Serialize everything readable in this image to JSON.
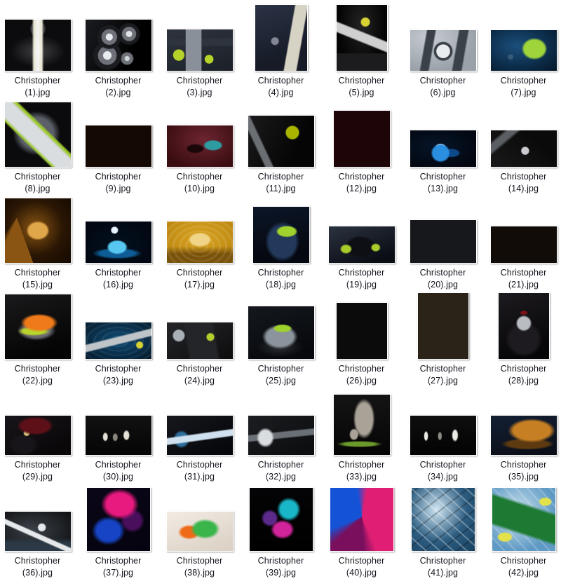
{
  "view": {
    "background_color": "#ffffff",
    "label_color": "#14141e",
    "columns": 7,
    "rows": 6,
    "item_count": 42,
    "name_prefix": "Christopher",
    "extension": ".jpg",
    "column_centers": [
      53,
      168,
      284,
      400,
      515,
      631,
      746
    ],
    "row_label_tops": [
      103,
      240,
      377,
      514,
      651,
      788
    ]
  },
  "files": [
    {
      "index": 1,
      "name_line1": "Christopher",
      "name_line2": "(1).jpg",
      "thumb": {
        "w": 94,
        "h": 73,
        "art": "flashlight-vertical-yellow",
        "bg": "#0c0c0f",
        "c1": "#e8e4d0",
        "c2": "#cfd532",
        "c3": "#3a3a42"
      }
    },
    {
      "index": 2,
      "name_line1": "Christopher",
      "name_line2": "(2).jpg",
      "thumb": {
        "w": 94,
        "h": 73,
        "art": "three-flashlight-heads",
        "bg": "#070709",
        "c1": "#b9bcc2",
        "c2": "#6e7278",
        "c3": "#1a1c20"
      }
    },
    {
      "index": 3,
      "name_line1": "Christopher",
      "name_line2": "(3).jpg",
      "thumb": {
        "w": 94,
        "h": 59,
        "art": "gear-flatlay-tools",
        "bg": "#1b2028",
        "c1": "#b6d32a",
        "c2": "#8a9099",
        "c3": "#2e343e"
      }
    },
    {
      "index": 4,
      "name_line1": "Christopher",
      "name_line2": "(4).jpg",
      "thumb": {
        "w": 74,
        "h": 94,
        "art": "dark-blue-box-package",
        "bg": "#161b27",
        "c1": "#d6d2c4",
        "c2": "#2b3345",
        "c3": "#7fb0cf"
      }
    },
    {
      "index": 5,
      "name_line1": "Christopher",
      "name_line2": "(5).jpg",
      "thumb": {
        "w": 72,
        "h": 94,
        "art": "flashlight-tilted-dark",
        "bg": "#050506",
        "c1": "#cfd0cf",
        "c2": "#d8d233",
        "c3": "#1c1c1e"
      }
    },
    {
      "index": 6,
      "name_line1": "Christopher",
      "name_line2": "(6).jpg",
      "thumb": {
        "w": 94,
        "h": 58,
        "art": "wet-chronograph-watch",
        "bg": "#9aa1a8",
        "c1": "#e9ecef",
        "c2": "#3b4149",
        "c3": "#c6ccd2"
      }
    },
    {
      "index": 7,
      "name_line1": "Christopher",
      "name_line2": "(7).jpg",
      "thumb": {
        "w": 94,
        "h": 58,
        "art": "green-dive-light-underwater",
        "bg": "#061728",
        "c1": "#9fd53a",
        "c2": "#1b4f7c",
        "c3": "#0c2c49"
      }
    },
    {
      "index": 8,
      "name_line1": "Christopher",
      "name_line2": "(8).jpg",
      "thumb": {
        "w": 94,
        "h": 92,
        "art": "green-torch-splash-spotlight",
        "bg": "#0b0b0d",
        "c1": "#d9dde0",
        "c2": "#9cc72e",
        "c3": "#5b6068"
      }
    },
    {
      "index": 9,
      "name_line1": "Christopher",
      "name_line2": "(9).jpg",
      "thumb": {
        "w": 94,
        "h": 59,
        "art": "orange-whisky-ice-bottle",
        "bg": "#150903",
        "c1": "#e79a22",
        "c2": "#c0611a",
        "c3": "#3a1a08"
      }
    },
    {
      "index": 10,
      "name_line1": "Christopher",
      "name_line2": "(10).jpg",
      "thumb": {
        "w": 94,
        "h": 59,
        "art": "teal-loafer-shoes-red",
        "bg": "#3a0d12",
        "c1": "#2f9aa0",
        "c2": "#6d2530",
        "c3": "#1b0609"
      }
    },
    {
      "index": 11,
      "name_line1": "Christopher",
      "name_line2": "(11).jpg",
      "thumb": {
        "w": 94,
        "h": 73,
        "art": "dark-machinery-green-dial",
        "bg": "#050505",
        "c1": "#aab500",
        "c2": "#6b6f74",
        "c3": "#1a1a1c"
      }
    },
    {
      "index": 12,
      "name_line1": "Christopher",
      "name_line2": "(12).jpg",
      "thumb": {
        "w": 80,
        "h": 80,
        "art": "silver-watch-red-glow",
        "bg": "#1d0508",
        "c1": "#e3e6ea",
        "c2": "#8b1420",
        "c3": "#4a0a10"
      }
    },
    {
      "index": 13,
      "name_line1": "Christopher",
      "name_line2": "(13).jpg",
      "thumb": {
        "w": 94,
        "h": 52,
        "art": "blue-cosmetic-jar",
        "bg": "#03060f",
        "c1": "#2a8fe0",
        "c2": "#0d4a8a",
        "c3": "#061528"
      }
    },
    {
      "index": 14,
      "name_line1": "Christopher",
      "name_line2": "(14).jpg",
      "thumb": {
        "w": 94,
        "h": 52,
        "art": "bw-camera-gear",
        "bg": "#0a0a0a",
        "c1": "#c9cbce",
        "c2": "#5b5e62",
        "c3": "#19191b"
      }
    },
    {
      "index": 15,
      "name_line1": "Christopher",
      "name_line2": "(15).jpg",
      "thumb": {
        "w": 94,
        "h": 92,
        "art": "gold-jar-amber-silk",
        "bg": "#120800",
        "c1": "#e0a64a",
        "c2": "#8a5512",
        "c3": "#2a1604"
      }
    },
    {
      "index": 16,
      "name_line1": "Christopher",
      "name_line2": "(16).jpg",
      "thumb": {
        "w": 94,
        "h": 59,
        "art": "blue-jar-moon",
        "bg": "#020610",
        "c1": "#57c7f2",
        "c2": "#0e5d96",
        "c3": "#03111f"
      }
    },
    {
      "index": 17,
      "name_line1": "Christopher",
      "name_line2": "(17).jpg",
      "thumb": {
        "w": 94,
        "h": 59,
        "art": "gold-jar-ripples",
        "bg": "#b7820d",
        "c1": "#f0d488",
        "c2": "#7a530a",
        "c3": "#d9a422"
      }
    },
    {
      "index": 18,
      "name_line1": "Christopher",
      "name_line2": "(18).jpg",
      "thumb": {
        "w": 80,
        "h": 80,
        "art": "blue-helmet-green-accent",
        "bg": "#050810",
        "c1": "#9fd22c",
        "c2": "#23395c",
        "c3": "#0c1628"
      }
    },
    {
      "index": 19,
      "name_line1": "Christopher",
      "name_line2": "(19).jpg",
      "thumb": {
        "w": 94,
        "h": 52,
        "art": "black-helmet-green-trim",
        "bg": "#0a0d14",
        "c1": "#a8cd2b",
        "c2": "#2b3240",
        "c3": "#11151e"
      }
    },
    {
      "index": 20,
      "name_line1": "Christopher",
      "name_line2": "(20).jpg",
      "thumb": {
        "w": 94,
        "h": 61,
        "art": "tool-bench-flatlay",
        "bg": "#16181b",
        "c1": "#b6d32a",
        "c2": "#71757c",
        "c3": "#26292e"
      }
    },
    {
      "index": 21,
      "name_line1": "Christopher",
      "name_line2": "(21).jpg",
      "thumb": {
        "w": 94,
        "h": 52,
        "art": "bottle-dust-explosion",
        "bg": "#120c08",
        "c1": "#d8d4cc",
        "c2": "#7a6248",
        "c3": "#241a12"
      }
    },
    {
      "index": 22,
      "name_line1": "Christopher",
      "name_line2": "(22).jpg",
      "thumb": {
        "w": 94,
        "h": 92,
        "art": "orange-running-shoe",
        "bg": "#050505",
        "c1": "#ef7a1a",
        "c2": "#b8d32a",
        "c3": "#1a1a1c"
      }
    },
    {
      "index": 23,
      "name_line1": "Christopher",
      "name_line2": "(23).jpg",
      "thumb": {
        "w": 94,
        "h": 52,
        "art": "flashlight-blue-water",
        "bg": "#061c2e",
        "c1": "#bfc4c8",
        "c2": "#0f4b74",
        "c3": "#d6d233"
      }
    },
    {
      "index": 24,
      "name_line1": "Christopher",
      "name_line2": "(24).jpg",
      "thumb": {
        "w": 94,
        "h": 52,
        "art": "garage-tools-green-light",
        "bg": "#0d0d0e",
        "c1": "#a8b0b6",
        "c2": "#b4cf2c",
        "c3": "#242528"
      }
    },
    {
      "index": 25,
      "name_line1": "Christopher",
      "name_line2": "(25).jpg",
      "thumb": {
        "w": 94,
        "h": 75,
        "art": "helmet-splash-green",
        "bg": "#07090c",
        "c1": "#9fd22c",
        "c2": "#8b949c",
        "c3": "#14181e"
      }
    },
    {
      "index": 26,
      "name_line1": "Christopher",
      "name_line2": "(26).jpg",
      "thumb": {
        "w": 72,
        "h": 80,
        "art": "canister-hands-dark",
        "bg": "#0b0b0c",
        "c1": "#c3b58d",
        "c2": "#5d5a52",
        "c3": "#1c1c1e"
      }
    },
    {
      "index": 27,
      "name_line1": "Christopher",
      "name_line2": "(27).jpg",
      "thumb": {
        "w": 72,
        "h": 94,
        "art": "perfume-bottle-golden-curtain",
        "bg": "#2b2318",
        "c1": "#e6c877",
        "c2": "#8d7441",
        "c3": "#15110a"
      }
    },
    {
      "index": 28,
      "name_line1": "Christopher",
      "name_line2": "(28).jpg",
      "thumb": {
        "w": 72,
        "h": 94,
        "art": "motorcycle-dark-red",
        "bg": "#060507",
        "c1": "#b9bcc0",
        "c2": "#7d1016",
        "c3": "#1d1b1f"
      }
    },
    {
      "index": 29,
      "name_line1": "Christopher",
      "name_line2": "(29).jpg",
      "thumb": {
        "w": 94,
        "h": 56,
        "art": "dark-motorcycle-red-seat",
        "bg": "#0a0709",
        "c1": "#d7c37a",
        "c2": "#5e1018",
        "c3": "#18151a"
      }
    },
    {
      "index": 30,
      "name_line1": "Christopher",
      "name_line2": "(30).jpg",
      "thumb": {
        "w": 94,
        "h": 56,
        "art": "three-lit-objects-black",
        "bg": "#050505",
        "c1": "#e4e0d6",
        "c2": "#8a867c",
        "c3": "#111111"
      }
    },
    {
      "index": 31,
      "name_line1": "Christopher",
      "name_line2": "(31).jpg",
      "thumb": {
        "w": 94,
        "h": 56,
        "art": "flashlight-beam-blue",
        "bg": "#07080c",
        "c1": "#cfe1ef",
        "c2": "#2e6f9c",
        "c3": "#16181d"
      }
    },
    {
      "index": 32,
      "name_line1": "Christopher",
      "name_line2": "(32).jpg",
      "thumb": {
        "w": 94,
        "h": 56,
        "art": "torch-grey-light",
        "bg": "#0d0e10",
        "c1": "#dadde0",
        "c2": "#6b7076",
        "c3": "#1b1d20"
      }
    },
    {
      "index": 33,
      "name_line1": "Christopher",
      "name_line2": "(33).jpg",
      "thumb": {
        "w": 80,
        "h": 86,
        "art": "stone-sculpture-green-base",
        "bg": "#050505",
        "c1": "#a9a296",
        "c2": "#6b9a2a",
        "c3": "#141414"
      }
    },
    {
      "index": 34,
      "name_line1": "Christopher",
      "name_line2": "(34).jpg",
      "thumb": {
        "w": 94,
        "h": 56,
        "art": "three-white-shapes-black",
        "bg": "#030303",
        "c1": "#eceae4",
        "c2": "#8d8b86",
        "c3": "#0e0e0e"
      }
    },
    {
      "index": 35,
      "name_line1": "Christopher",
      "name_line2": "(35).jpg",
      "thumb": {
        "w": 94,
        "h": 56,
        "art": "brown-work-boot",
        "bg": "#0b0d16",
        "c1": "#c67f23",
        "c2": "#5d3a10",
        "c3": "#132033"
      }
    },
    {
      "index": 36,
      "name_line1": "Christopher",
      "name_line2": "(36).jpg",
      "thumb": {
        "w": 94,
        "h": 56,
        "art": "ink-splash-bw",
        "bg": "#111214",
        "c1": "#e5e8ea",
        "c2": "#2b3a46",
        "c3": "#1c1e22"
      }
    },
    {
      "index": 37,
      "name_line1": "Christopher",
      "name_line2": "(37).jpg",
      "thumb": {
        "w": 90,
        "h": 90,
        "art": "pink-blue-ink-cloud",
        "bg": "#0a0618",
        "c1": "#e8197f",
        "c2": "#1644c4",
        "c3": "#4a0f5c"
      }
    },
    {
      "index": 38,
      "name_line1": "Christopher",
      "name_line2": "(38).jpg",
      "thumb": {
        "w": 94,
        "h": 56,
        "art": "green-orange-ink-white",
        "bg": "#f3ece4",
        "c1": "#39b54a",
        "c2": "#ef6a16",
        "c3": "#d9cfc2"
      }
    },
    {
      "index": 39,
      "name_line1": "Christopher",
      "name_line2": "(39).jpg",
      "thumb": {
        "w": 90,
        "h": 90,
        "art": "teal-magenta-ink-black",
        "bg": "#040406",
        "c1": "#19b6c7",
        "c2": "#d1249a",
        "c3": "#5b2a8a"
      }
    },
    {
      "index": 40,
      "name_line1": "Christopher",
      "name_line2": "(40).jpg",
      "thumb": {
        "w": 90,
        "h": 90,
        "art": "pink-blue-swirl",
        "bg": "#2a0a3a",
        "c1": "#e01f74",
        "c2": "#1553d6",
        "c3": "#7a0f5e"
      }
    },
    {
      "index": 41,
      "name_line1": "Christopher",
      "name_line2": "(41).jpg",
      "thumb": {
        "w": 90,
        "h": 90,
        "art": "ice-cubes-blue",
        "bg": "#2c5c80",
        "c1": "#cfe5f2",
        "c2": "#17405e",
        "c3": "#79a8c6"
      }
    },
    {
      "index": 42,
      "name_line1": "Christopher",
      "name_line2": "(42).jpg",
      "thumb": {
        "w": 90,
        "h": 90,
        "art": "seven-up-can-ice-lemon",
        "bg": "#5f9ac4",
        "c1": "#1d7a33",
        "c2": "#e3e24a",
        "c3": "#cfe4f0"
      }
    }
  ]
}
